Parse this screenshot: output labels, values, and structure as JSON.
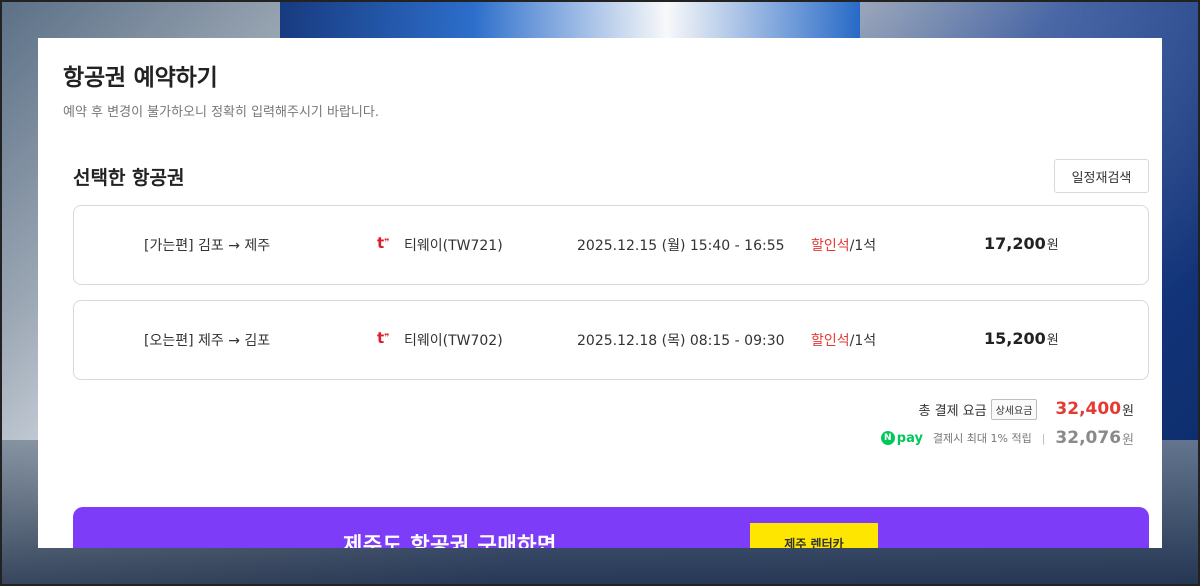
{
  "page": {
    "title": "항공권 예약하기",
    "subtitle": "예약 후 변경이 불가하오니 정확히 입력해주시기 바랍니다."
  },
  "section": {
    "title": "선택한 항공권",
    "research_button": "일정재검색"
  },
  "flights": [
    {
      "route": "[가는편] 김포 → 제주",
      "airline_logo_icon": "tway-logo-icon",
      "airline": "티웨이(TW721)",
      "schedule": "2025.12.15 (월) 15:40 - 16:55",
      "seat_class": "할인석",
      "seat_count": "/1석",
      "price": "17,200",
      "price_unit": "원"
    },
    {
      "route": "[오는편] 제주 → 김포",
      "airline_logo_icon": "tway-logo-icon",
      "airline": "티웨이(TW702)",
      "schedule": "2025.12.18 (목) 08:15 - 09:30",
      "seat_class": "할인석",
      "seat_count": "/1석",
      "price": "15,200",
      "price_unit": "원"
    }
  ],
  "total": {
    "label": "총 결제 요금",
    "detail_button": "상세요금",
    "amount": "32,400",
    "unit": "원"
  },
  "npay": {
    "logo_n": "N",
    "logo_text": "pay",
    "benefit": "결제시 최대 1% 적립",
    "separator": "|",
    "amount": "32,076",
    "unit": "원"
  },
  "banner": {
    "text": "제주도 항공권 구매하면",
    "badge": "제주 렌터카"
  },
  "colors": {
    "accent_red": "#e53935",
    "npay_green": "#03c75a",
    "banner_purple": "#7d3cf8",
    "badge_yellow": "#ffe600"
  }
}
